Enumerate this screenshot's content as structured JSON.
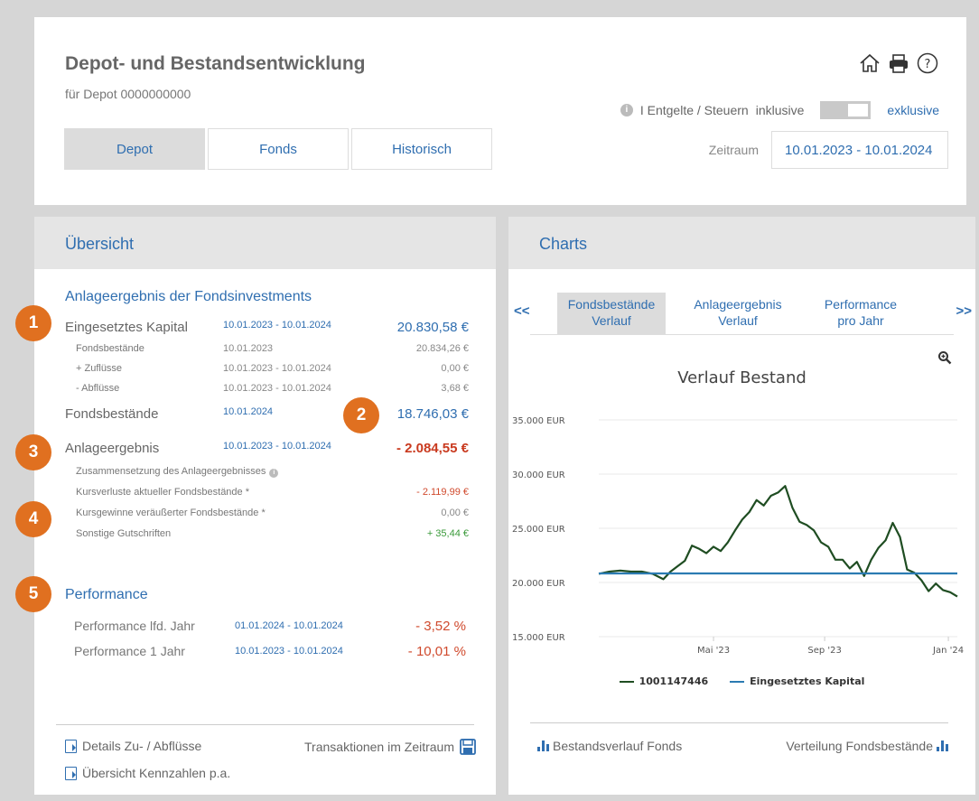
{
  "header": {
    "title": "Depot- und Bestandsentwicklung",
    "subtitle": "für Depot 0000000000",
    "fees_label": "I Entgelte / Steuern",
    "fees_inclusive": "inklusive",
    "fees_exclusive": "exklusive",
    "tabs": [
      {
        "label": "Depot",
        "active": true
      },
      {
        "label": "Fonds",
        "active": false
      },
      {
        "label": "Historisch",
        "active": false
      }
    ],
    "period_label": "Zeitraum",
    "period_value": "10.01.2023 - 10.01.2024"
  },
  "overview": {
    "header": "Übersicht",
    "section_title": "Anlageergebnis der Fondsinvestments",
    "invested_capital": {
      "label": "Eingesetztes Kapital",
      "date": "10.01.2023 - 10.01.2024",
      "value": "20.830,58 €"
    },
    "fund_holdings_start": {
      "label": "Fondsbestände",
      "date": "10.01.2023",
      "value": "20.834,26 €"
    },
    "inflows": {
      "label": "+ Zuflüsse",
      "date": "10.01.2023 - 10.01.2024",
      "value": "0,00 €"
    },
    "outflows": {
      "label": "- Abflüsse",
      "date": "10.01.2023 - 10.01.2024",
      "value": "3,68 €"
    },
    "fund_holdings_end": {
      "label": "Fondsbestände",
      "date": "10.01.2024",
      "value": "18.746,03 €"
    },
    "result": {
      "label": "Anlageergebnis",
      "date": "10.01.2023 - 10.01.2024",
      "value": "- 2.084,55 €"
    },
    "composition_label": "Zusammensetzung des Anlageergebnisses",
    "losses": {
      "label": "Kursverluste aktueller Fondsbestände *",
      "value": "- 2.119,99 €"
    },
    "gains": {
      "label": "Kursgewinne veräußerter Fondsbestände *",
      "value": "0,00 €"
    },
    "credits": {
      "label": "Sonstige Gutschriften",
      "value": "+ 35,44 €"
    },
    "performance_title": "Performance",
    "perf_ytd": {
      "label": "Performance lfd. Jahr",
      "date": "01.01.2024 - 10.01.2024",
      "value": "- 3,52 %"
    },
    "perf_1y": {
      "label": "Performance 1 Jahr",
      "date": "10.01.2023 - 10.01.2024",
      "value": "- 10,01 %"
    },
    "footer_details": "Details Zu- / Abflüsse",
    "footer_transactions": "Transaktionen im Zeitraum",
    "footer_kpis": "Übersicht Kennzahlen p.a."
  },
  "badges": [
    "1",
    "2",
    "3",
    "4",
    "5"
  ],
  "charts": {
    "header": "Charts",
    "nav_prev": "<<",
    "nav_next": ">>",
    "tabs": [
      {
        "line1": "Fondsbestände",
        "line2": "Verlauf",
        "active": true
      },
      {
        "line1": "Anlageergebnis",
        "line2": "Verlauf",
        "active": false
      },
      {
        "line1": "Performance",
        "line2": "pro Jahr",
        "active": false
      }
    ],
    "footer_left": "Bestandsverlauf Fonds",
    "footer_right": "Verteilung Fondsbestände"
  },
  "colors": {
    "accent": "#2f6eb0",
    "badge": "#e07020",
    "negative": "#d04a2d",
    "positive": "#3a9a3a",
    "series_fund": "#1f4d22",
    "series_capital": "#2b7bb2"
  },
  "chart_data": {
    "type": "line",
    "title": "Verlauf Bestand",
    "y_ticks": [
      "35.000 EUR",
      "30.000 EUR",
      "25.000 EUR",
      "20.000 EUR",
      "15.000 EUR"
    ],
    "y_tick_values": [
      35000,
      30000,
      25000,
      20000,
      15000
    ],
    "x_ticks": [
      "Mai '23",
      "Sep '23",
      "Jan '24"
    ],
    "x_tick_positions": [
      0.32,
      0.63,
      0.975
    ],
    "ylim": [
      15000,
      35000
    ],
    "series": [
      {
        "name": "1001147446",
        "color": "#1f4d22",
        "x": [
          0,
          0.03,
          0.06,
          0.09,
          0.12,
          0.15,
          0.18,
          0.2,
          0.22,
          0.24,
          0.26,
          0.28,
          0.3,
          0.32,
          0.34,
          0.36,
          0.38,
          0.4,
          0.42,
          0.44,
          0.46,
          0.48,
          0.5,
          0.52,
          0.54,
          0.56,
          0.58,
          0.6,
          0.62,
          0.64,
          0.66,
          0.68,
          0.7,
          0.72,
          0.74,
          0.76,
          0.78,
          0.8,
          0.82,
          0.84,
          0.86,
          0.88,
          0.9,
          0.92,
          0.94,
          0.96,
          0.98,
          1.0
        ],
        "values": [
          20800,
          21000,
          21100,
          21000,
          21000,
          20800,
          20300,
          21000,
          21500,
          22000,
          23400,
          23100,
          22700,
          23300,
          22900,
          23700,
          24800,
          25800,
          26500,
          27600,
          27100,
          28000,
          28300,
          28900,
          26900,
          25600,
          25300,
          24800,
          23700,
          23300,
          22100,
          22100,
          21300,
          21900,
          20600,
          22100,
          23200,
          23900,
          25500,
          24200,
          21200,
          20900,
          20200,
          19200,
          19900,
          19300,
          19100,
          18700
        ]
      },
      {
        "name": "Eingesetztes Kapital",
        "color": "#2b7bb2",
        "x": [
          0,
          1.0
        ],
        "values": [
          20830,
          20830
        ]
      }
    ]
  }
}
